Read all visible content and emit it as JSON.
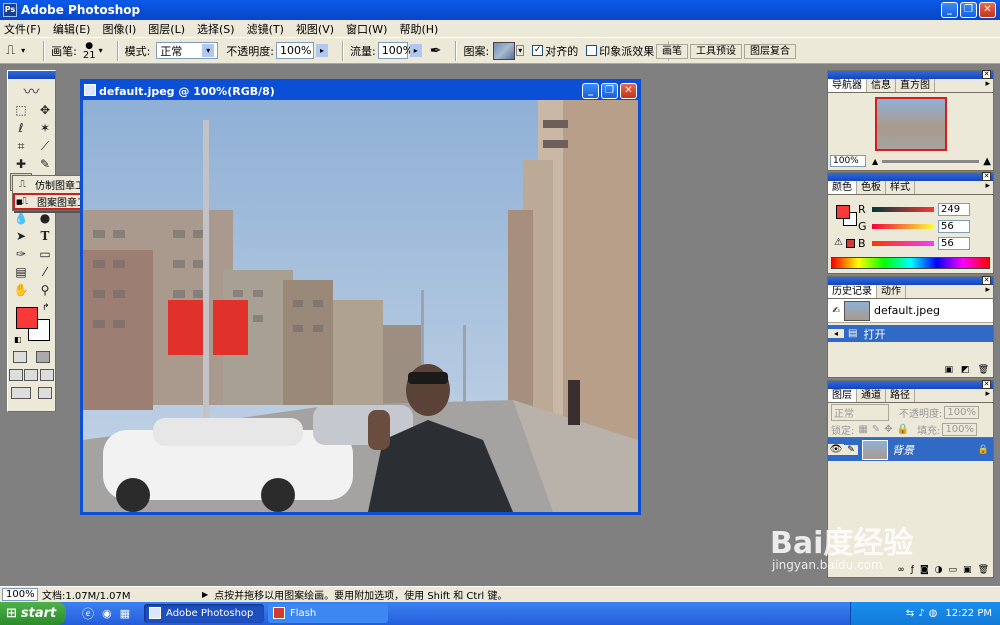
{
  "window": {
    "title": "Adobe Photoshop"
  },
  "menu": [
    "文件(F)",
    "编辑(E)",
    "图像(I)",
    "图层(L)",
    "选择(S)",
    "滤镜(T)",
    "视图(V)",
    "窗口(W)",
    "帮助(H)"
  ],
  "options_bar": {
    "brush_label": "画笔:",
    "brush_size": "21",
    "mode_label": "模式:",
    "mode_value": "正常",
    "opacity_label": "不透明度:",
    "opacity_value": "100%",
    "flow_label": "流量:",
    "flow_value": "100%",
    "pattern_label": "图案:",
    "aligned_label": "对齐的",
    "aligned_checked": true,
    "impressionist_label": "印象派效果",
    "impressionist_checked": false,
    "palette_well_tabs": [
      "画笔",
      "工具预设",
      "图层复合"
    ]
  },
  "tool_flyout": {
    "items": [
      {
        "label": "仿制图章工具",
        "shortcut": "S",
        "selected": false
      },
      {
        "label": "图案图章工具",
        "shortcut": "S",
        "selected": true
      }
    ]
  },
  "document": {
    "title": "default.jpeg @ 100%(RGB/8)"
  },
  "navigator_panel": {
    "tabs": [
      "导航器",
      "信息",
      "直方图"
    ],
    "zoom": "100%"
  },
  "color_panel": {
    "tabs": [
      "颜色",
      "色板",
      "样式"
    ],
    "channels": [
      {
        "label": "R",
        "value": "249"
      },
      {
        "label": "G",
        "value": "56"
      },
      {
        "label": "B",
        "value": "56"
      }
    ],
    "foreground": "#f93838",
    "background": "#ffffff"
  },
  "history_panel": {
    "tabs": [
      "历史记录",
      "动作"
    ],
    "snapshot": "default.jpeg",
    "steps": [
      "打开"
    ]
  },
  "layers_panel": {
    "tabs": [
      "图层",
      "通道",
      "路径"
    ],
    "blend_mode": "正常",
    "opacity_label": "不透明度:",
    "opacity_value": "100%",
    "lock_label": "锁定:",
    "fill_label": "填充:",
    "fill_value": "100%",
    "layers": [
      {
        "name": "背景"
      }
    ]
  },
  "status_bar": {
    "zoom": "100%",
    "doc_size": "文档:1.07M/1.07M",
    "hint": "点按并拖移以用图案绘画。要用附加选项，使用 Shift 和 Ctrl 键。"
  },
  "taskbar": {
    "start_label": "start",
    "tasks": [
      "Adobe Photoshop",
      "Flash"
    ],
    "lang": "EN",
    "clock": "12:22 PM"
  },
  "watermark": {
    "brand": "Bai度经验",
    "url": "jingyan.baidu.com"
  }
}
